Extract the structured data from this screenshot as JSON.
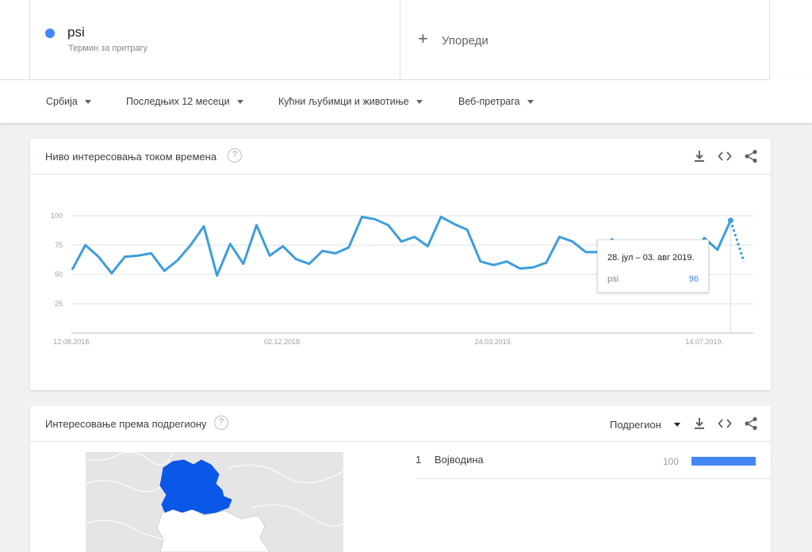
{
  "terms": [
    {
      "name": "psi",
      "sub": "Термин за претрагу",
      "color": "#4285f4"
    }
  ],
  "compare": {
    "label": "Упореди"
  },
  "filters": [
    {
      "label": "Србија"
    },
    {
      "label": "Последњих 12 месеци"
    },
    {
      "label": "Кућни љубимци и животиње"
    },
    {
      "label": "Веб-претрага"
    }
  ],
  "interest_over_time": {
    "title": "Ниво интересовања током времена",
    "tooltip": {
      "date": "28. јул – 03. авг 2019.",
      "series": "psi",
      "value": "96"
    }
  },
  "subregion": {
    "title": "Интересовање према подрегиону",
    "select_label": "Подрегион",
    "rows": [
      {
        "rank": "1",
        "name": "Војводина",
        "value": "100",
        "fraction": 1.0
      }
    ]
  },
  "colors": {
    "accent": "#4285f4",
    "line": "#3d9ddc"
  },
  "chart_data": {
    "type": "line",
    "ylim": [
      0,
      100
    ],
    "yticks": [
      "100",
      "75",
      "50",
      "25"
    ],
    "xticks": [
      "12.08.2018.",
      "02.12.2018.",
      "24.03.2019.",
      "14.07.2019."
    ],
    "x": [
      "12.08.2018.",
      "19.08.2018.",
      "26.08.2018.",
      "02.09.2018.",
      "09.09.2018.",
      "16.09.2018.",
      "23.09.2018.",
      "30.09.2018.",
      "07.10.2018.",
      "14.10.2018.",
      "21.10.2018.",
      "28.10.2018.",
      "04.11.2018.",
      "11.11.2018.",
      "18.11.2018.",
      "25.11.2018.",
      "02.12.2018.",
      "09.12.2018.",
      "16.12.2018.",
      "23.12.2018.",
      "30.12.2018.",
      "06.01.2019.",
      "13.01.2019.",
      "20.01.2019.",
      "27.01.2019.",
      "03.02.2019.",
      "10.02.2019.",
      "17.02.2019.",
      "24.02.2019.",
      "03.03.2019.",
      "10.03.2019.",
      "17.03.2019.",
      "24.03.2019.",
      "31.03.2019.",
      "07.04.2019.",
      "14.04.2019.",
      "21.04.2019.",
      "28.04.2019.",
      "05.05.2019.",
      "12.05.2019.",
      "19.05.2019.",
      "26.05.2019.",
      "02.06.2019.",
      "09.06.2019.",
      "16.06.2019.",
      "23.06.2019.",
      "30.06.2019.",
      "07.07.2019.",
      "14.07.2019.",
      "21.07.2019.",
      "28.07.2019.",
      "04.08.2019."
    ],
    "series": [
      {
        "name": "psi",
        "values": [
          54,
          75,
          65,
          51,
          65,
          66,
          68,
          53,
          62,
          75,
          91,
          49,
          76,
          59,
          92,
          66,
          74,
          63,
          59,
          70,
          68,
          73,
          99,
          97,
          92,
          78,
          82,
          74,
          99,
          93,
          88,
          61,
          58,
          61,
          55,
          56,
          60,
          82,
          78,
          69,
          69,
          80,
          70,
          65,
          54,
          47,
          68,
          65,
          81,
          71,
          96,
          61
        ],
        "partial_last": true
      }
    ]
  }
}
